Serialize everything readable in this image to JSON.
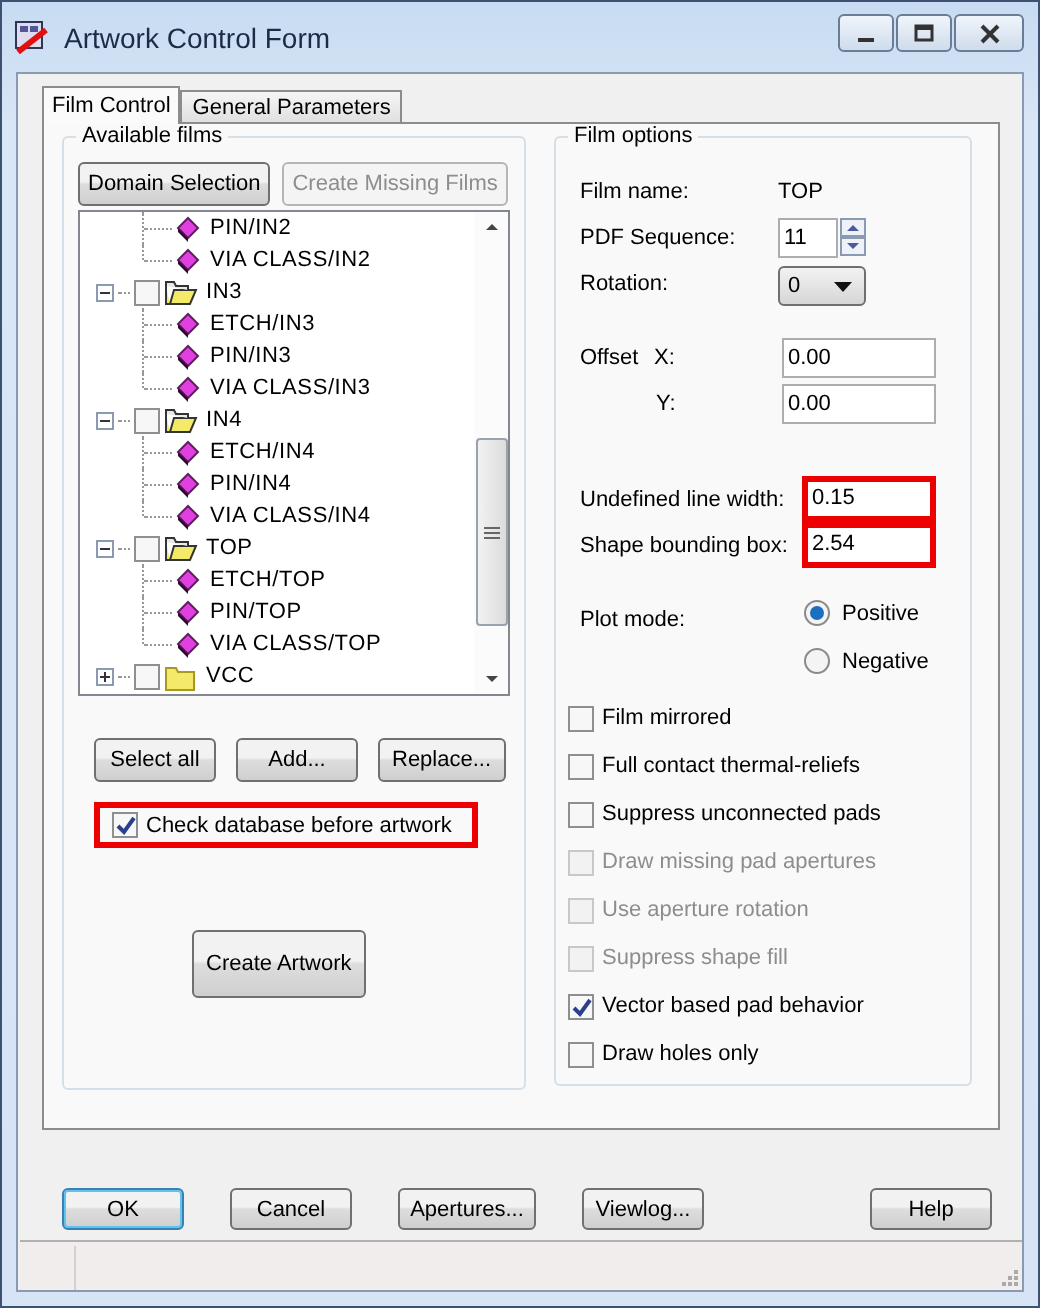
{
  "window": {
    "title": "Artwork Control Form"
  },
  "tabs": [
    {
      "label": "Film Control",
      "selected": true
    },
    {
      "label": "General Parameters",
      "selected": false
    }
  ],
  "available_films": {
    "title": "Available films",
    "buttons": [
      {
        "label": "Domain Selection",
        "disabled": false
      },
      {
        "label": "Create Missing Films",
        "disabled": true
      }
    ],
    "tree": [
      {
        "kind": "group",
        "expanded": true,
        "children": [
          {
            "kind": "film",
            "label": "PIN/IN2"
          },
          {
            "kind": "film",
            "label": "VIA CLASS/IN2"
          }
        ]
      },
      {
        "kind": "group",
        "label": "IN3",
        "checked": false,
        "expanded": true,
        "children": [
          {
            "kind": "film",
            "label": "ETCH/IN3"
          },
          {
            "kind": "film",
            "label": "PIN/IN3"
          },
          {
            "kind": "film",
            "label": "VIA CLASS/IN3"
          }
        ]
      },
      {
        "kind": "group",
        "label": "IN4",
        "checked": false,
        "expanded": true,
        "children": [
          {
            "kind": "film",
            "label": "ETCH/IN4"
          },
          {
            "kind": "film",
            "label": "PIN/IN4"
          },
          {
            "kind": "film",
            "label": "VIA CLASS/IN4"
          }
        ]
      },
      {
        "kind": "group",
        "label": "TOP",
        "checked": false,
        "expanded": true,
        "children": [
          {
            "kind": "film",
            "label": "ETCH/TOP"
          },
          {
            "kind": "film",
            "label": "PIN/TOP"
          },
          {
            "kind": "film",
            "label": "VIA CLASS/TOP"
          }
        ]
      },
      {
        "kind": "group",
        "label": "VCC",
        "checked": false,
        "expanded": false
      }
    ],
    "list_buttons": [
      "Select all",
      "Add...",
      "Replace..."
    ],
    "check_database": {
      "label": "Check database before artwork",
      "checked": true,
      "highlighted": true
    },
    "create_button": "Create Artwork"
  },
  "film_options": {
    "title": "Film options",
    "film_name": {
      "label": "Film name:",
      "value": "TOP"
    },
    "pdf_sequence": {
      "label": "PDF Sequence:",
      "value": "11"
    },
    "rotation": {
      "label": "Rotation:",
      "value": "0"
    },
    "offset": {
      "label": "Offset",
      "x_label": "X:",
      "x_value": "0.00",
      "y_label": "Y:",
      "y_value": "0.00"
    },
    "undefined_line_width": {
      "label": "Undefined line width:",
      "value": "0.15",
      "highlighted": true
    },
    "shape_bounding_box": {
      "label": "Shape bounding box:",
      "value": "2.54",
      "highlighted": true
    },
    "plot_mode": {
      "label": "Plot mode:",
      "options": [
        {
          "label": "Positive",
          "selected": true
        },
        {
          "label": "Negative",
          "selected": false
        }
      ]
    },
    "options": [
      {
        "label": "Film mirrored",
        "checked": false,
        "disabled": false
      },
      {
        "label": "Full contact thermal-reliefs",
        "checked": false,
        "disabled": false
      },
      {
        "label": "Suppress unconnected pads",
        "checked": false,
        "disabled": false
      },
      {
        "label": "Draw missing pad apertures",
        "checked": false,
        "disabled": true
      },
      {
        "label": "Use aperture rotation",
        "checked": false,
        "disabled": true
      },
      {
        "label": "Suppress shape fill",
        "checked": false,
        "disabled": true
      },
      {
        "label": "Vector based pad behavior",
        "checked": true,
        "disabled": false
      },
      {
        "label": "Draw holes only",
        "checked": false,
        "disabled": false
      }
    ]
  },
  "buttons": [
    {
      "label": "OK",
      "default": true
    },
    {
      "label": "Cancel",
      "default": false
    },
    {
      "label": "Apertures...",
      "default": false
    },
    {
      "label": "Viewlog...",
      "default": false
    },
    {
      "label": "Help",
      "default": false
    }
  ]
}
